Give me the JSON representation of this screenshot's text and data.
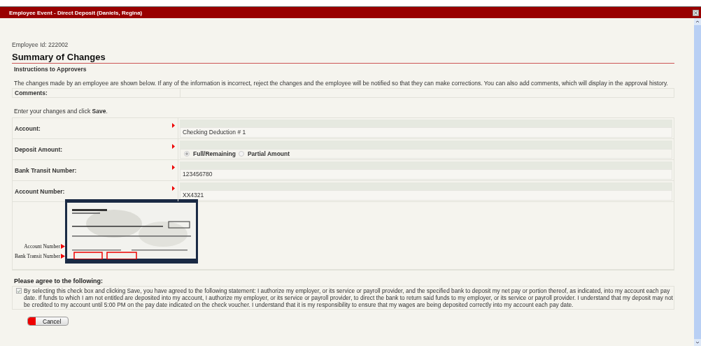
{
  "window": {
    "title": "Employee Event - Direct Deposit (Daniels, Regina)"
  },
  "employee_id": "Employee Id: 222002",
  "heading": "Summary of Changes",
  "instructions": {
    "title": "Instructions to Approvers",
    "text": "The changes made by an employee are shown below. If any of the information is incorrect, reject the changes and the employee will be notified so that they can make corrections. You can also add comments, which will display in the approval history."
  },
  "comments": {
    "label": "Comments:"
  },
  "enter_hint": "Enter your changes and click **Save**.",
  "fields": [
    {
      "kind": "text",
      "label": "Account:",
      "required": true,
      "value": "Checking Deduction # 1"
    },
    {
      "kind": "radio",
      "label": "Deposit Amount:",
      "required": true,
      "options": [
        {
          "label": "Full/Remaining",
          "selected": true
        },
        {
          "label": "Partial Amount",
          "selected": false
        }
      ]
    },
    {
      "kind": "text",
      "label": "Bank Transit Number:",
      "required": true,
      "value": "123456780"
    },
    {
      "kind": "text",
      "label": "Account Number:",
      "required": true,
      "value": "XX4321"
    }
  ],
  "check_illustration": {
    "kind": "picture",
    "labels": [
      "Account Number",
      "Bank Transit Number"
    ]
  },
  "agreement": {
    "title": "Please agree to the following:",
    "checked": true,
    "disabled": true,
    "text": "By selecting this check box and clicking Save, you have agreed to the following statement: I authorize my employer, or its service or payroll provider, and the specified bank to deposit my net pay or portion thereof, as indicated, into my account each pay date. If funds to which I am not entitled are deposited into my account, I authorize my employer, or its service or payroll provider, to direct the bank to return said funds to my employer, or its service or payroll provider. I understand that my deposit may not be credited to my account until 5:00 PM on the pay date indicated on the check voucher. I understand that it is my responsibility to ensure that my wages are being deposited correctly into my account each pay date."
  },
  "buttons": [
    "Cancel"
  ]
}
